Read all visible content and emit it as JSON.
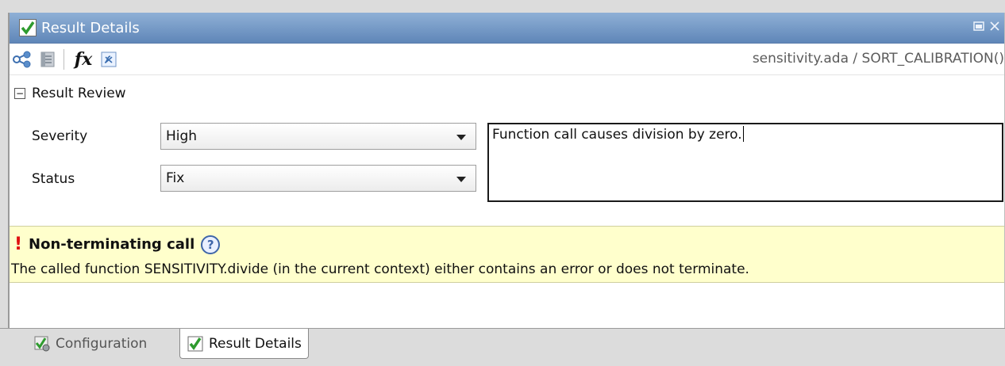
{
  "window": {
    "title": "Result Details",
    "controls": [
      "restore-icon",
      "close-icon"
    ]
  },
  "toolbar": {
    "buttons": [
      {
        "name": "call-graph-icon"
      },
      {
        "name": "file-icon"
      },
      {
        "name": "fx",
        "label": "fx"
      },
      {
        "name": "variable-icon"
      }
    ],
    "breadcrumb": "sensitivity.ada / SORT_CALIBRATION()"
  },
  "result_review": {
    "section_label": "Result Review",
    "collapse_glyph": "−",
    "severity": {
      "label": "Severity",
      "value": "High"
    },
    "status": {
      "label": "Status",
      "value": "Fix"
    },
    "comment": "Function call causes division by zero."
  },
  "message": {
    "marker": "!",
    "title": "Non-terminating call",
    "help_glyph": "?",
    "body": "The called function SENSITIVITY.divide (in the current context) either contains an error or does not terminate."
  },
  "tabs": [
    {
      "label": "Configuration",
      "active": false
    },
    {
      "label": "Result Details",
      "active": true
    }
  ],
  "colors": {
    "titlebar": "#6f93c4",
    "message_bg": "#ffffcc",
    "error_marker": "#e01010",
    "check_green": "#2e9b2e"
  }
}
